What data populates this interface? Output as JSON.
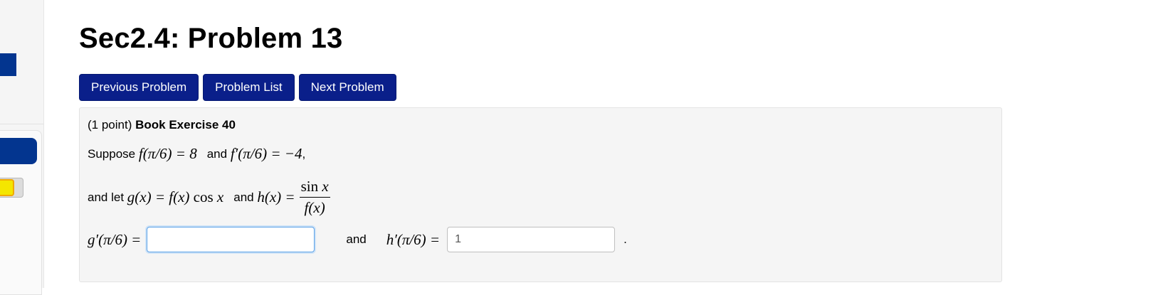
{
  "page": {
    "title": "Sec2.4: Problem 13"
  },
  "nav": {
    "previous_label": "Previous Problem",
    "list_label": "Problem List",
    "next_label": "Next Problem"
  },
  "problem": {
    "points": "(1 point)",
    "heading": "Book Exercise 40",
    "suppose_word": "Suppose",
    "f_given": "f(π/6) = 8",
    "and_word": "and",
    "fprime_given": "f′(π/6) = −4",
    "comma": ",",
    "and_let": "and let",
    "g_def_lhs": "g(x) = f(x)",
    "g_def_cos": "cos",
    "g_def_x": "x",
    "h_def_lhs": "h(x) =",
    "h_num_sin": "sin",
    "h_num_x": "x",
    "h_den": "f(x)",
    "g_prime_label": "g′(π/6) =",
    "g_prime_value": "",
    "h_prime_label": "h′(π/6) =",
    "h_prime_value": "1",
    "final_period": "."
  },
  "colors": {
    "button_bg": "#0a1f8a",
    "accent_blue": "#03358f",
    "toggle_yellow": "#f4e600"
  }
}
